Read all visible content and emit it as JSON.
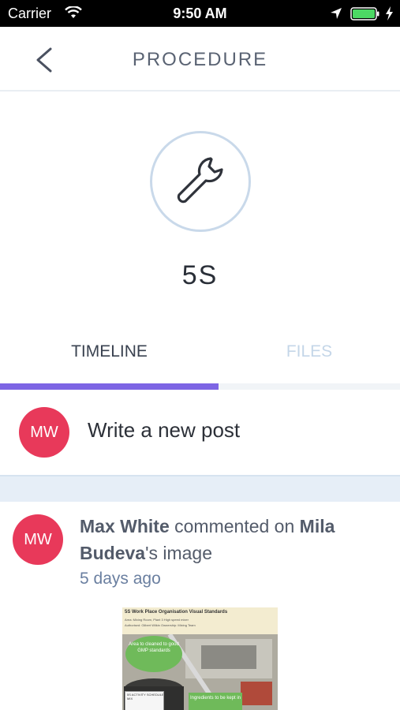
{
  "status_bar": {
    "carrier": "Carrier",
    "time": "9:50 AM",
    "icons": [
      "wifi-icon",
      "location-icon",
      "battery-icon",
      "charging-icon"
    ]
  },
  "header": {
    "title": "PROCEDURE",
    "back_icon": "chevron-left-icon"
  },
  "procedure": {
    "icon": "wrench-icon",
    "name": "5S"
  },
  "tabs": {
    "items": [
      {
        "label": "TIMELINE",
        "active": true
      },
      {
        "label": "FILES",
        "active": false
      }
    ],
    "indicator_color": "#7d65e4"
  },
  "composer": {
    "avatar_initials": "MW",
    "placeholder": "Write a new post"
  },
  "feed": {
    "items": [
      {
        "avatar_initials": "MW",
        "actor": "Max White",
        "action": " commented on ",
        "target": "Mila Budeva",
        "suffix": "'s image",
        "time": "5 days ago",
        "image": {
          "title": "5S Work Place Organisation Visual Standards",
          "line1": "Area: Mixing Room, Plant 3 High speed mixer",
          "line2": "Authorised: Gilbert Wilkin     Ownership: Mixing Team",
          "bubble_text": "Area to cleaned to good GMP standards",
          "callout_text": "Ingredients to be kept in",
          "card_title": "5S ACTIVITY SCHEDULE",
          "card_line": "MIX"
        }
      }
    ]
  },
  "colors": {
    "avatar": "#e8395a",
    "title_text": "#5a6373",
    "separator": "#e6eef7",
    "inactive_tab": "#c4d6e8"
  }
}
